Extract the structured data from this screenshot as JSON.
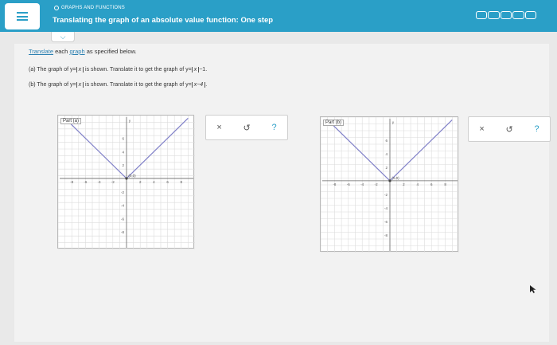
{
  "header": {
    "section": "GRAPHS AND FUNCTIONS",
    "title": "Translating the graph of an absolute value function: One step"
  },
  "instructions": {
    "link": "Translate",
    "middle": " each ",
    "link2": "graph",
    "rest": " as specified below."
  },
  "parts": [
    {
      "prefix": "(a) The graph of y=",
      "var": "x",
      "middle": " is shown. Translate it to get the graph of y=",
      "var2": "x",
      "suffix": "−1."
    },
    {
      "prefix": "(b) The graph of y=",
      "var": "x",
      "middle": " is shown. Translate it to get the graph of y=",
      "var2": "x−4",
      "suffix": "."
    }
  ],
  "graphs": [
    {
      "label": "Part (a)",
      "origin_label": "(0,0)",
      "x_tick_labels": [
        "-8",
        "-6",
        "-4",
        "-2",
        "2",
        "4",
        "6",
        "8"
      ],
      "y_tick_labels": [
        "6",
        "4",
        "2",
        "-2",
        "-4",
        "-6",
        "-8"
      ],
      "y_axis_label": "y"
    },
    {
      "label": "Part (b)",
      "origin_label": "(0,0)",
      "x_tick_labels": [
        "-8",
        "-6",
        "-4",
        "-2",
        "2",
        "4",
        "6",
        "8"
      ],
      "y_tick_labels": [
        "6",
        "4",
        "2",
        "-2",
        "-4",
        "-6",
        "-8"
      ],
      "y_axis_label": "y"
    }
  ],
  "tools": {
    "close": "×",
    "undo": "↺",
    "help": "?"
  },
  "colors": {
    "accent": "#2a9fc7",
    "graph_line": "#8080c8"
  }
}
